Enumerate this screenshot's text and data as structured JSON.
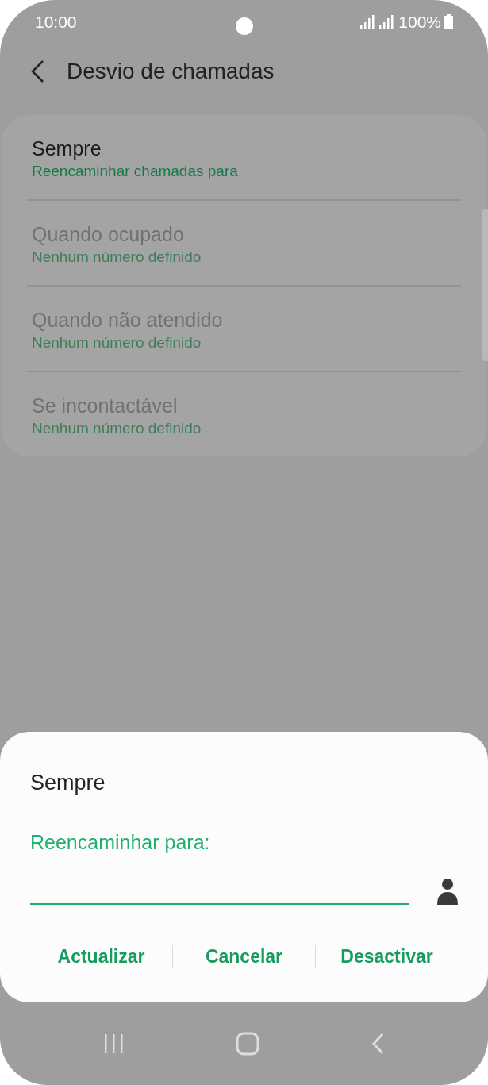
{
  "status_bar": {
    "time": "10:00",
    "battery": "100%"
  },
  "header": {
    "title": "Desvio de chamadas"
  },
  "options": [
    {
      "title": "Sempre",
      "subtitle": "Reencaminhar chamadas para",
      "disabled": false
    },
    {
      "title": "Quando ocupado",
      "subtitle": "Nenhum número definido",
      "disabled": true
    },
    {
      "title": "Quando não atendido",
      "subtitle": "Nenhum número definido",
      "disabled": true
    },
    {
      "title": "Se incontactável",
      "subtitle": "Nenhum número definido",
      "disabled": true
    }
  ],
  "dialog": {
    "title": "Sempre",
    "field_label": "Reencaminhar para:",
    "buttons": [
      "Actualizar",
      "Cancelar",
      "Desactivar"
    ]
  }
}
